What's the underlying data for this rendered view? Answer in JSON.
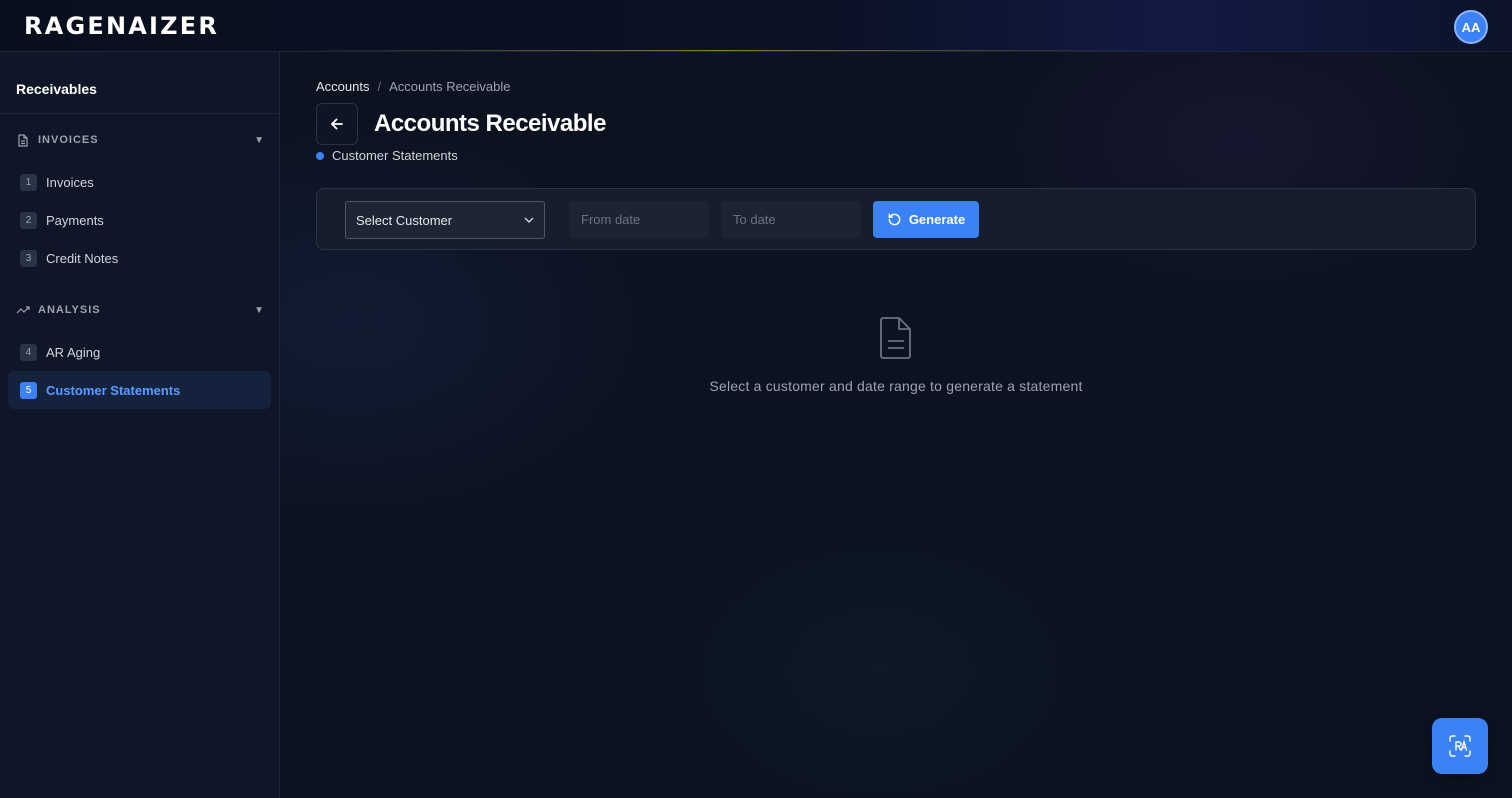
{
  "app": {
    "logo_text": "RAGENAIZER",
    "user_initials": "AA"
  },
  "sidebar": {
    "title": "Receivables",
    "sections": [
      {
        "label": "INVOICES",
        "icon": "document-icon",
        "items": [
          {
            "num": "1",
            "label": "Invoices"
          },
          {
            "num": "2",
            "label": "Payments"
          },
          {
            "num": "3",
            "label": "Credit Notes"
          }
        ]
      },
      {
        "label": "ANALYSIS",
        "icon": "trend-up-icon",
        "items": [
          {
            "num": "4",
            "label": "AR Aging"
          },
          {
            "num": "5",
            "label": "Customer Statements",
            "active": true
          }
        ]
      }
    ]
  },
  "breadcrumb": {
    "items": [
      "Accounts",
      "Accounts Receivable"
    ],
    "separator": "/"
  },
  "header": {
    "title": "Accounts Receivable",
    "subtitle": "Customer Statements"
  },
  "filters": {
    "customer_select": "Select Customer",
    "from_date_placeholder": "From date",
    "to_date_placeholder": "To date",
    "generate_label": "Generate"
  },
  "empty_state": {
    "message": "Select a customer and date range to generate a statement"
  },
  "colors": {
    "accent": "#3b82f6",
    "background": "#0c1220",
    "sidebar": "#0e1628"
  }
}
